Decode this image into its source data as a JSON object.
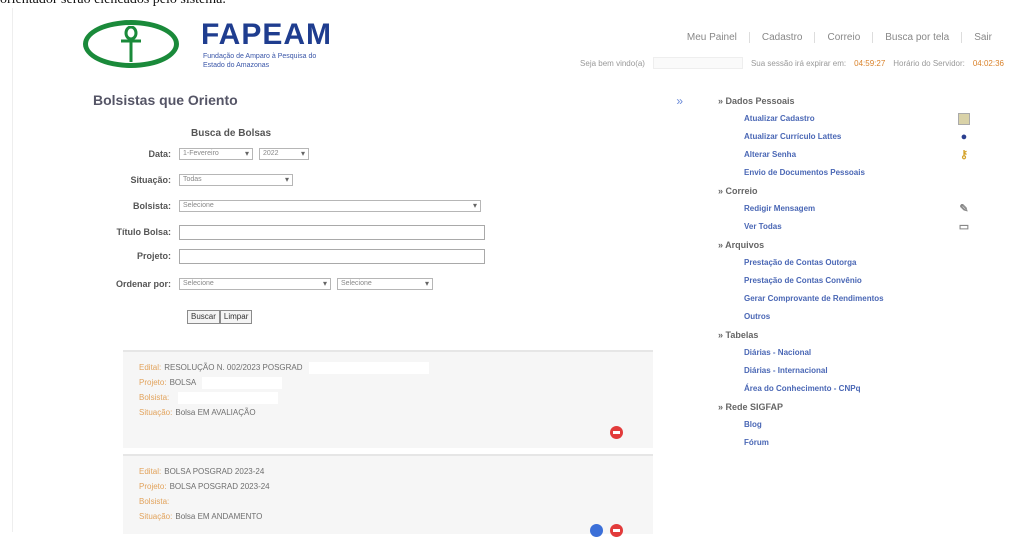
{
  "caption": "orientador serão elencados pelo sistema.",
  "header": {
    "logo_text": "FAPEAM",
    "logo_subtitle": "Fundação de Amparo à Pesquisa do Estado do Amazonas",
    "nav": [
      "Meu Painel",
      "Cadastro",
      "Correio",
      "Busca por tela",
      "Sair"
    ],
    "welcome_label": "Seja bem vindo(a)",
    "session_label": "Sua sessão irá expirar em:",
    "session_time": "04:59:27",
    "server_label": "Horário do Servidor:",
    "server_time": "04:02:36"
  },
  "main": {
    "title": "Bolsistas que Oriento",
    "collapse_glyph": "»",
    "form_title": "Busca de Bolsas",
    "fields": {
      "data": {
        "label": "Data:",
        "month": "1-Fevereiro",
        "year": "2022"
      },
      "situacao": {
        "label": "Situação:",
        "value": "Todas"
      },
      "bolsista": {
        "label": "Bolsista:",
        "value": "Selecione"
      },
      "titulo": {
        "label": "Título Bolsa:",
        "value": ""
      },
      "projeto": {
        "label": "Projeto:",
        "value": ""
      },
      "ordenar": {
        "label": "Ordenar por:",
        "value1": "Selecione",
        "value2": "Selecione"
      }
    },
    "buttons": {
      "buscar": "Buscar",
      "limpar": "Limpar"
    },
    "cards": [
      {
        "edital_key": "Edital:",
        "edital": "RESOLUÇÃO N. 002/2023 POSGRAD",
        "projeto_key": "Projeto:",
        "projeto": "BOLSA",
        "bolsista_key": "Bolsista:",
        "bolsista": "",
        "situacao_key": "Situação:",
        "situacao": "Bolsa EM AVALIAÇÃO"
      },
      {
        "edital_key": "Edital:",
        "edital": "BOLSA POSGRAD 2023-24",
        "projeto_key": "Projeto:",
        "projeto": "BOLSA POSGRAD 2023-24",
        "bolsista_key": "Bolsista:",
        "bolsista": "",
        "situacao_key": "Situação:",
        "situacao": "Bolsa EM ANDAMENTO"
      }
    ]
  },
  "sidebar": {
    "sections": [
      {
        "title": "Dados Pessoais",
        "items": [
          {
            "label": "Atualizar Cadastro",
            "icon": "id-card-icon"
          },
          {
            "label": "Atualizar Currículo Lattes",
            "icon": "lattes-icon"
          },
          {
            "label": "Alterar Senha",
            "icon": "key-icon"
          },
          {
            "label": "Envio de Documentos Pessoais",
            "icon": ""
          }
        ]
      },
      {
        "title": "Correio",
        "items": [
          {
            "label": "Redigir Mensagem",
            "icon": "pencil-icon"
          },
          {
            "label": "Ver Todas",
            "icon": "inbox-icon"
          }
        ]
      },
      {
        "title": "Arquivos",
        "items": [
          {
            "label": "Prestação de Contas Outorga",
            "icon": ""
          },
          {
            "label": "Prestação de Contas Convênio",
            "icon": ""
          },
          {
            "label": "Gerar Comprovante de Rendimentos",
            "icon": ""
          },
          {
            "label": "Outros",
            "icon": ""
          }
        ]
      },
      {
        "title": "Tabelas",
        "items": [
          {
            "label": "Diárias - Nacional",
            "icon": ""
          },
          {
            "label": "Diárias - Internacional",
            "icon": ""
          },
          {
            "label": "Área do Conhecimento - CNPq",
            "icon": ""
          }
        ]
      },
      {
        "title": "Rede SIGFAP",
        "items": [
          {
            "label": "Blog",
            "icon": ""
          },
          {
            "label": "Fórum",
            "icon": ""
          }
        ]
      }
    ]
  },
  "colors": {
    "brand_green": "#1a8a3a",
    "brand_blue": "#1f3d8f",
    "link_blue": "#4a67b5",
    "key_orange": "#e2a35c",
    "delete_red": "#e23b3b"
  }
}
